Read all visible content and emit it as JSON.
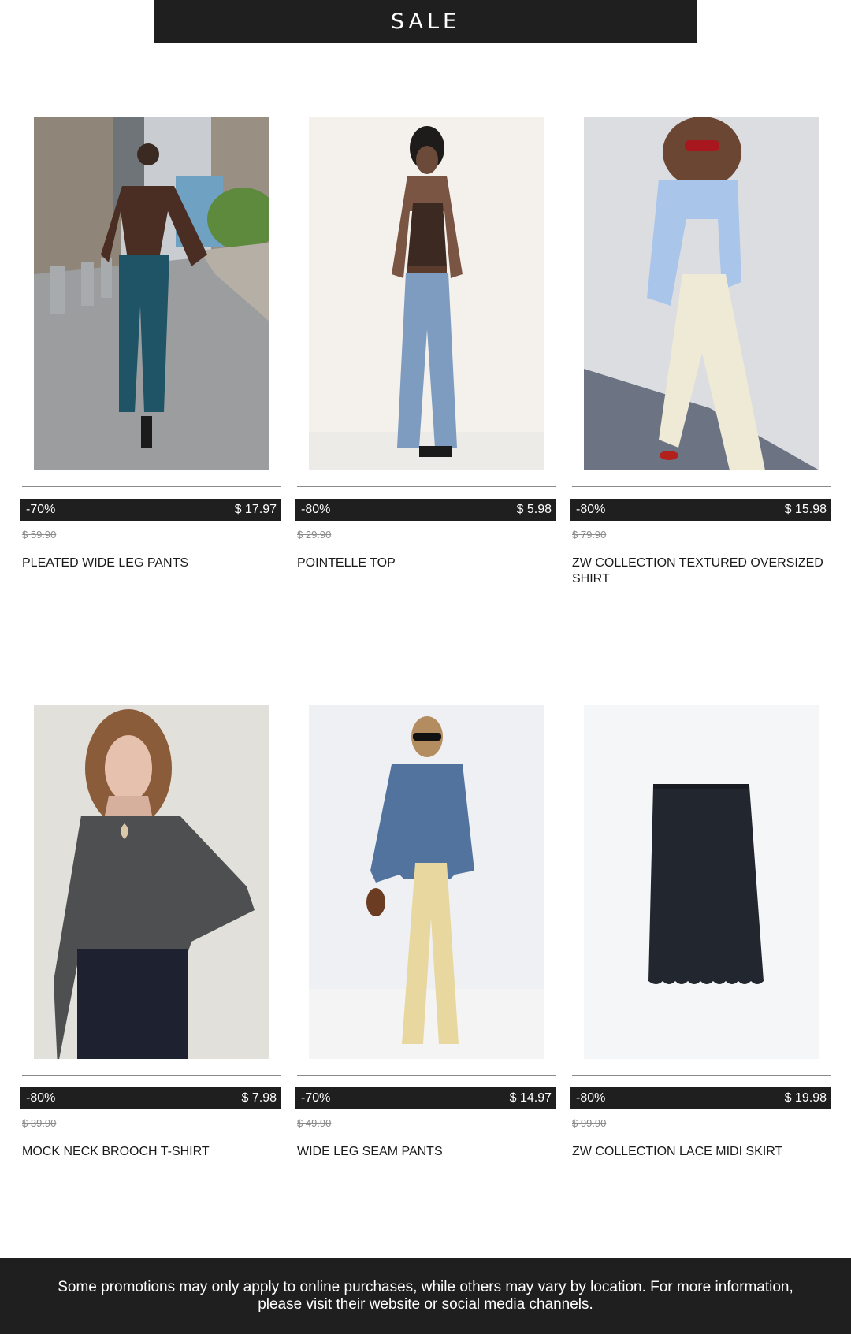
{
  "banner": {
    "title": "SALE"
  },
  "products": [
    {
      "discount": "-70%",
      "price": "$ 17.97",
      "old_price": "$ 59.90",
      "name": "PLEATED WIDE LEG PANTS"
    },
    {
      "discount": "-80%",
      "price": "$ 5.98",
      "old_price": "$ 29.90",
      "name": "POINTELLE TOP"
    },
    {
      "discount": "-80%",
      "price": "$ 15.98",
      "old_price": "$ 79.90",
      "name": "ZW COLLECTION TEXTURED OVERSIZED SHIRT"
    },
    {
      "discount": "-80%",
      "price": "$ 7.98",
      "old_price": "$ 39.90",
      "name": "MOCK NECK BROOCH T-SHIRT"
    },
    {
      "discount": "-70%",
      "price": "$ 14.97",
      "old_price": "$ 49.90",
      "name": "WIDE LEG SEAM PANTS"
    },
    {
      "discount": "-80%",
      "price": "$ 19.98",
      "old_price": "$ 99.90",
      "name": "ZW COLLECTION LACE MIDI SKIRT"
    }
  ],
  "footer": {
    "text": "Some promotions may only apply to online purchases, while others may vary by location. For more information, please visit their website or social media channels."
  },
  "colors": {
    "dark": "#1f1f1f",
    "strike": "#8a8a8a"
  }
}
